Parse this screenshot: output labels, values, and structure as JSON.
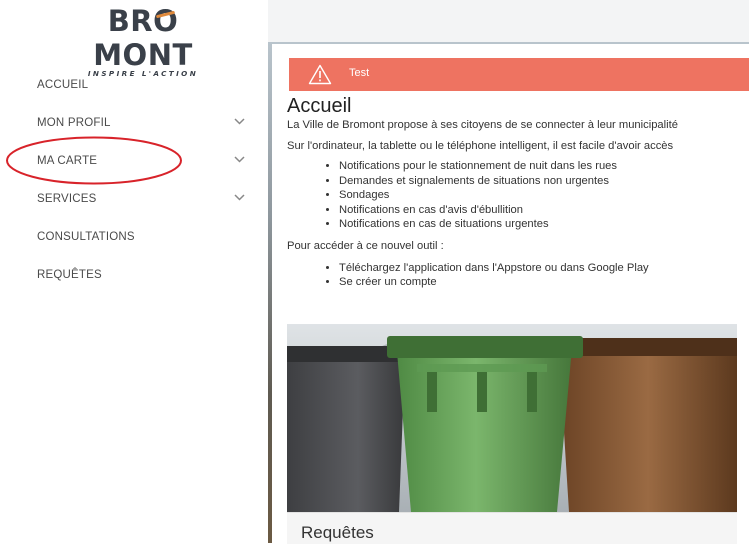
{
  "logo": {
    "wordmark_pre": "BR",
    "wordmark_o": "O",
    "wordmark_post": "MONT",
    "tagline": "INSPIRE L'ACTION"
  },
  "sidebar": {
    "items": [
      {
        "label": "ACCUEIL",
        "has_chevron": false
      },
      {
        "label": "MON PROFIL",
        "has_chevron": true
      },
      {
        "label": "MA CARTE",
        "has_chevron": true,
        "highlighted": true
      },
      {
        "label": "SERVICES",
        "has_chevron": true
      },
      {
        "label": "CONSULTATIONS",
        "has_chevron": false
      },
      {
        "label": "REQUÊTES",
        "has_chevron": false
      }
    ]
  },
  "alert": {
    "text": "Test",
    "color": "#ee7361",
    "icon": "warning-icon"
  },
  "main": {
    "title": "Accueil",
    "intro": "La Ville de Bromont propose à ses citoyens de se connecter à leur municipalité",
    "devices": "Sur l'ordinateur, la tablette ou le téléphone intelligent, il est facile d'avoir accès",
    "features": [
      "Notifications pour le stationnement de nuit dans les rues",
      "Demandes et signalements de situations non urgentes",
      "Sondages",
      "Notifications en cas d'avis d'ébullition",
      "Notifications en cas de situations urgentes"
    ],
    "access_intro": "Pour accéder à ce nouvel outil :",
    "steps": [
      "Téléchargez l'application dans l'Appstore ou dans Google Play",
      "Se créer un compte"
    ],
    "card_title": "Requêtes"
  },
  "colors": {
    "highlight_ellipse": "#d8232a",
    "logo_accent": "#e08a3c"
  }
}
